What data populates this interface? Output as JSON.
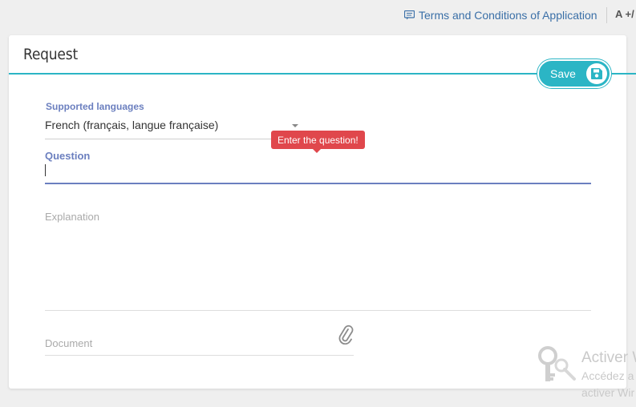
{
  "topbar": {
    "terms_link": "Terms and Conditions of Application",
    "terms_icon": "message-icon",
    "font_size_control": "A +/"
  },
  "card": {
    "title": "Request",
    "save_label": "Save",
    "save_icon": "floppy-disk-icon",
    "accent_color": "#2bb5c5"
  },
  "form": {
    "language": {
      "label": "Supported languages",
      "value": "French (français, langue française)"
    },
    "question": {
      "label": "Question",
      "value": "",
      "error_tooltip": "Enter the question!"
    },
    "explanation": {
      "placeholder": "Explanation"
    },
    "document": {
      "placeholder": "Document",
      "icon": "paperclip-icon"
    }
  },
  "watermark": {
    "title": "Activer W",
    "line1": "Accédez a",
    "line2": "activer Wir"
  },
  "colors": {
    "label": "#6b7fbf",
    "error": "#e0474c",
    "link": "#3a6fa7"
  }
}
